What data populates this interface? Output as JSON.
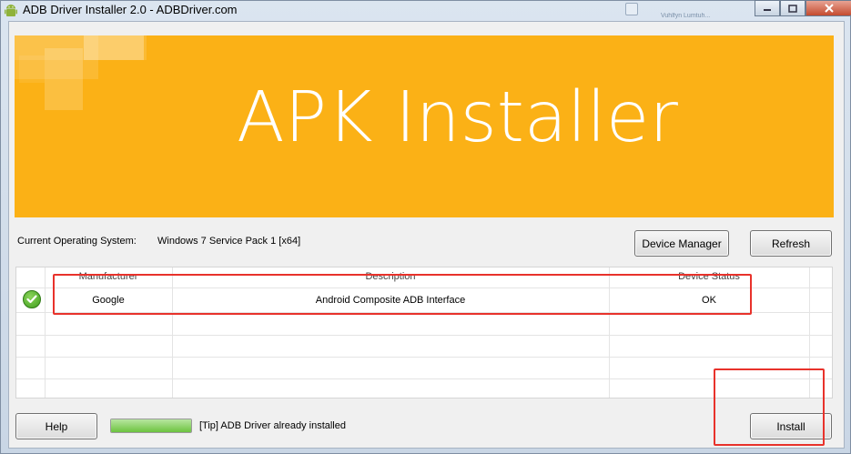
{
  "window": {
    "title": "ADB Driver Installer 2.0 - ADBDriver.com",
    "background_hint": "Vuhlfyn Lumtuh..."
  },
  "banner": {
    "title": "APK Installer",
    "background_color": "#fbb116"
  },
  "system": {
    "os_label": "Current Operating System:",
    "os_value": "Windows 7 Service Pack 1 [x64]"
  },
  "buttons": {
    "device_manager": "Device Manager",
    "refresh": "Refresh",
    "help": "Help",
    "install": "Install"
  },
  "table": {
    "columns": [
      "Manufacturer",
      "Description",
      "Device Status"
    ],
    "rows": [
      {
        "status_icon": "check-circle-icon",
        "manufacturer": "Google",
        "description": "Android Composite ADB Interface",
        "device_status": "OK"
      }
    ]
  },
  "footer": {
    "progress": 1.0,
    "tip": "[Tip] ADB Driver already installed"
  },
  "annotations": {
    "highlight_color": "#e8322b"
  }
}
